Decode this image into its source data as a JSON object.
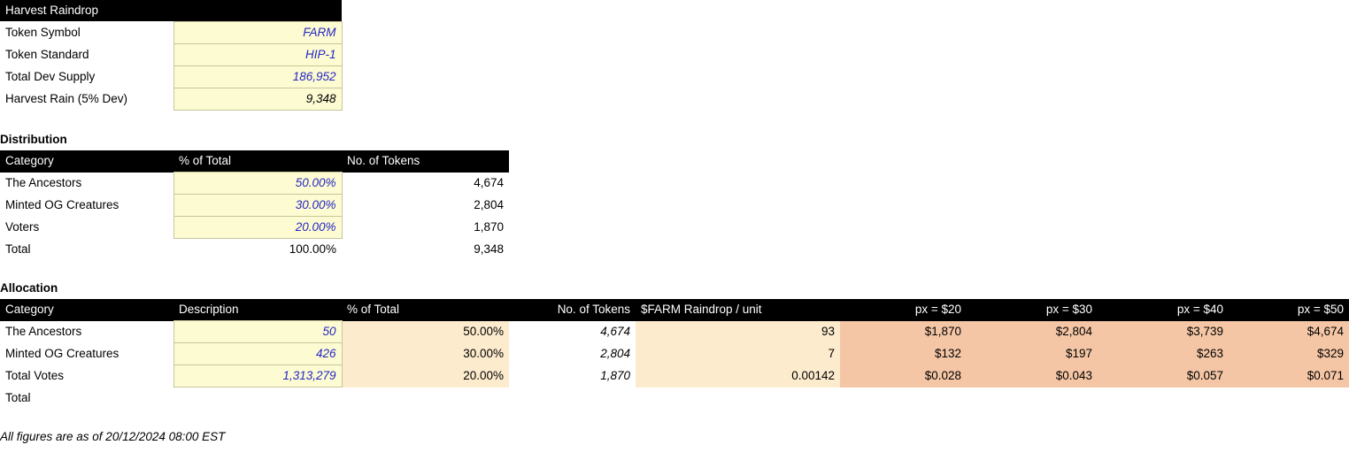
{
  "summary": {
    "title": "Harvest Raindrop",
    "rows": [
      {
        "label": "Token Symbol",
        "value": "FARM",
        "style": "blue"
      },
      {
        "label": "Token Standard",
        "value": "HIP-1",
        "style": "blue"
      },
      {
        "label": "Total Dev Supply",
        "value": "186,952",
        "style": "blue"
      },
      {
        "label": "Harvest Rain (5% Dev)",
        "value": "9,348",
        "style": "black"
      }
    ]
  },
  "distribution": {
    "title": "Distribution",
    "headers": [
      "Category",
      "% of Total",
      "No. of Tokens"
    ],
    "rows": [
      {
        "category": "The Ancestors",
        "pct": "50.00%",
        "tokens": "4,674"
      },
      {
        "category": "Minted OG Creatures",
        "pct": "30.00%",
        "tokens": "2,804"
      },
      {
        "category": "Voters",
        "pct": "20.00%",
        "tokens": "1,870"
      }
    ],
    "total": {
      "label": "Total",
      "pct": "100.00%",
      "tokens": "9,348"
    }
  },
  "allocation": {
    "title": "Allocation",
    "headers": [
      "Category",
      "Description",
      "% of Total",
      "No. of Tokens",
      "$FARM Raindrop / unit",
      "px = $20",
      "px = $30",
      "px = $40",
      "px = $50"
    ],
    "rows": [
      {
        "category": "The Ancestors",
        "description": "50",
        "pct": "50.00%",
        "tokens": "4,674",
        "per_unit": "93",
        "px20": "$1,870",
        "px30": "$2,804",
        "px40": "$3,739",
        "px50": "$4,674"
      },
      {
        "category": "Minted OG Creatures",
        "description": "426",
        "pct": "30.00%",
        "tokens": "2,804",
        "per_unit": "7",
        "px20": "$132",
        "px30": "$197",
        "px40": "$263",
        "px50": "$329"
      },
      {
        "category": "Total Votes",
        "description": "1,313,279",
        "pct": "20.00%",
        "tokens": "1,870",
        "per_unit": "0.00142",
        "px20": "$0.028",
        "px30": "$0.043",
        "px40": "$0.057",
        "px50": "$0.071"
      }
    ],
    "total_label": "Total"
  },
  "footnote": "All figures are as of 20/12/2024  08:00 EST",
  "colors": {
    "header_bg": "#000000",
    "header_fg": "#ffffff",
    "input_bg": "#fcfbd2",
    "input_fg": "#2727c4",
    "computed_bg": "#fdebcd",
    "price_bg": "#f5c6a5"
  }
}
